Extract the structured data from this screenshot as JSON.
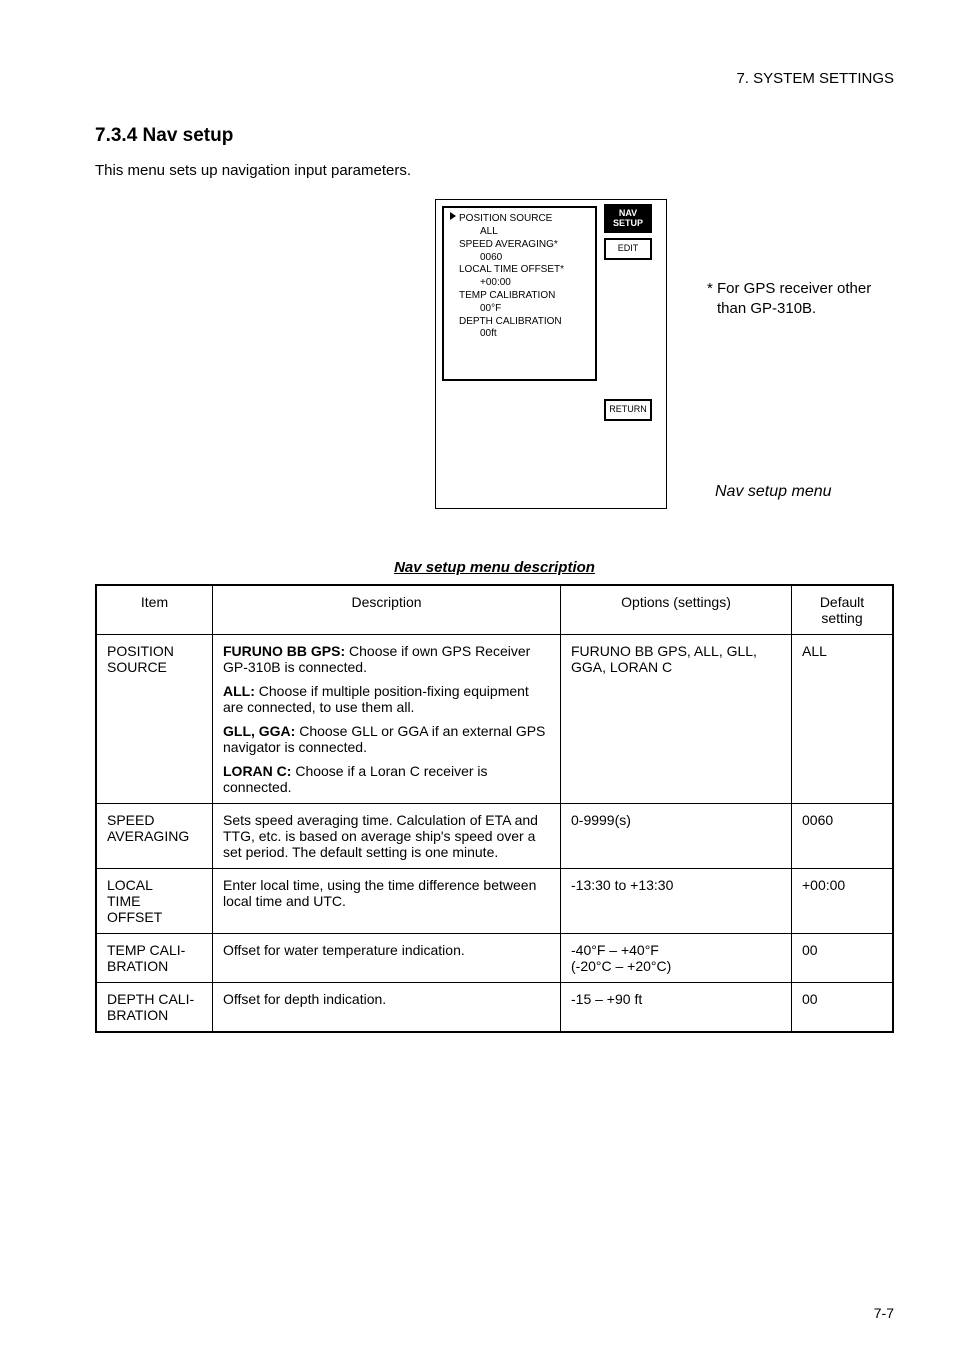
{
  "header_chapter": "7. SYSTEM SETTINGS",
  "section_heading": "7.3.4 Nav setup",
  "intro_text": "This menu sets up navigation input parameters.",
  "screen_menu": {
    "items": [
      {
        "label": "POSITION SOURCE",
        "value": "ALL"
      },
      {
        "label": "SPEED AVERAGING*",
        "value": "0060"
      },
      {
        "label": "LOCAL TIME OFFSET*",
        "value": "+00:00"
      },
      {
        "label": "TEMP CALIBRATION",
        "value": "00°F"
      },
      {
        "label": "DEPTH CALIBRATION",
        "value": "00ft"
      }
    ],
    "nav_label_top": "NAV",
    "nav_label_bottom": "SETUP",
    "edit_label": "EDIT",
    "return_label": "RETURN"
  },
  "side_note_line1": "* For GPS receiver other",
  "side_note_line2": "than GP-310B.",
  "figure_caption": "Nav setup menu",
  "table_title": "Nav setup menu description",
  "table": {
    "headers": [
      "Item",
      "Description",
      "Options (settings)",
      "Default setting"
    ],
    "rows": [
      {
        "item": "POSITION\nSOURCE",
        "desc_parts": [
          {
            "b": "FURUNO BB GPS:",
            "t": " Choose if own GPS Receiver GP-310B is connected."
          },
          {
            "b": "ALL:",
            "t": " Choose if multiple position-fixing equipment are connected, to use them all."
          },
          {
            "b": "GLL, GGA:",
            "t": " Choose GLL or GGA if an external GPS navigator is connected."
          },
          {
            "b": "LORAN C:",
            "t": " Choose if a Loran C receiver is connected."
          }
        ],
        "options": "FURUNO BB GPS, ALL, GLL, GGA, LORAN C",
        "def": "ALL"
      },
      {
        "item": "SPEED\nAVERAGING",
        "desc_plain": "Sets speed averaging time. Calculation of ETA and TTG, etc. is based on average ship's speed over a set period. The default setting is one minute.",
        "options": "0-9999(s)",
        "def": "0060"
      },
      {
        "item": "LOCAL\nTIME\nOFFSET",
        "desc_plain": "Enter local time, using the time difference between local time and UTC.",
        "options": "-13:30 to +13:30",
        "def": "+00:00"
      },
      {
        "item": "TEMP CALI-\nBRATION",
        "desc_plain": "Offset for water temperature indication.",
        "options": "-40°F – +40°F\n(-20°C – +20°C)",
        "def": "00"
      },
      {
        "item": "DEPTH CALI-\nBRATION",
        "desc_plain": "Offset for depth indication.",
        "options": "-15 – +90 ft",
        "def": "00"
      }
    ]
  },
  "page_number": "7-7"
}
